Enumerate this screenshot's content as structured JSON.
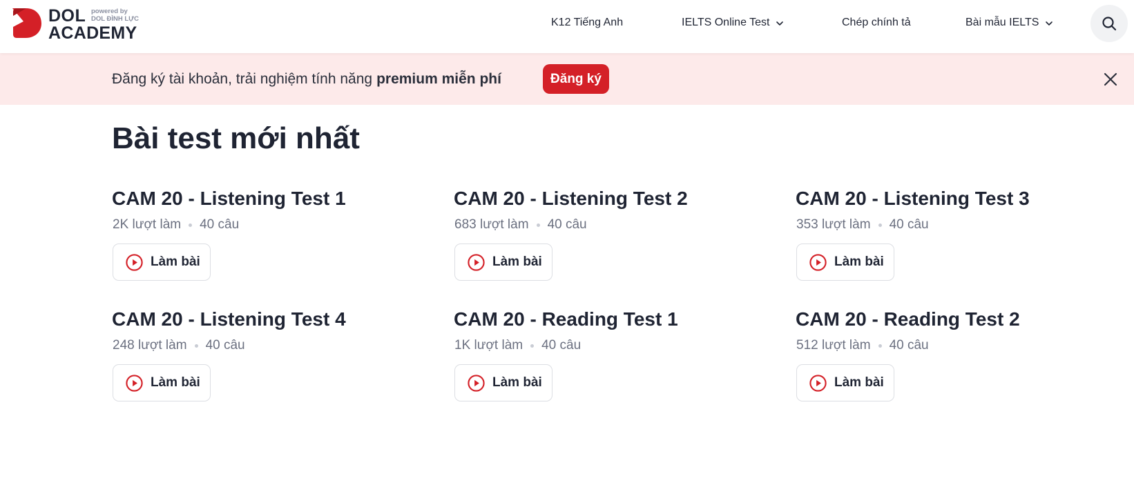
{
  "brand": {
    "name_line1": "DOL",
    "name_line2": "ACADEMY",
    "powered_by": "powered by",
    "powered_org": "DOL ĐÌNH LỰC",
    "accent_color": "#d42027"
  },
  "nav": {
    "items": [
      {
        "label": "K12 Tiếng Anh",
        "has_dropdown": false
      },
      {
        "label": "IELTS Online Test",
        "has_dropdown": true
      },
      {
        "label": "Chép chính tả",
        "has_dropdown": false
      },
      {
        "label": "Bài mẫu IELTS",
        "has_dropdown": true
      }
    ],
    "search_icon": "search-icon"
  },
  "banner": {
    "text": "Đăng ký tài khoản, trải nghiệm tính năng",
    "highlight": "premium miễn phí",
    "button_label": "Đăng ký",
    "close_icon": "close-icon",
    "background_color": "#fdeaea"
  },
  "main": {
    "title": "Bài test mới nhất",
    "tests": [
      {
        "title": "CAM 20 - Listening Test 1",
        "attempts": "2K lượt làm",
        "questions": "40 câu",
        "button_label": "Làm bài"
      },
      {
        "title": "CAM 20 - Listening Test 2",
        "attempts": "683 lượt làm",
        "questions": "40 câu",
        "button_label": "Làm bài"
      },
      {
        "title": "CAM 20 - Listening Test 3",
        "attempts": "353 lượt làm",
        "questions": "40 câu",
        "button_label": "Làm bài"
      },
      {
        "title": "CAM 20 - Listening Test 4",
        "attempts": "248 lượt làm",
        "questions": "40 câu",
        "button_label": "Làm bài"
      },
      {
        "title": "CAM 20 - Reading Test 1",
        "attempts": "1K lượt làm",
        "questions": "40 câu",
        "button_label": "Làm bài"
      },
      {
        "title": "CAM 20 - Reading Test 2",
        "attempts": "512 lượt làm",
        "questions": "40 câu",
        "button_label": "Làm bài"
      }
    ]
  }
}
